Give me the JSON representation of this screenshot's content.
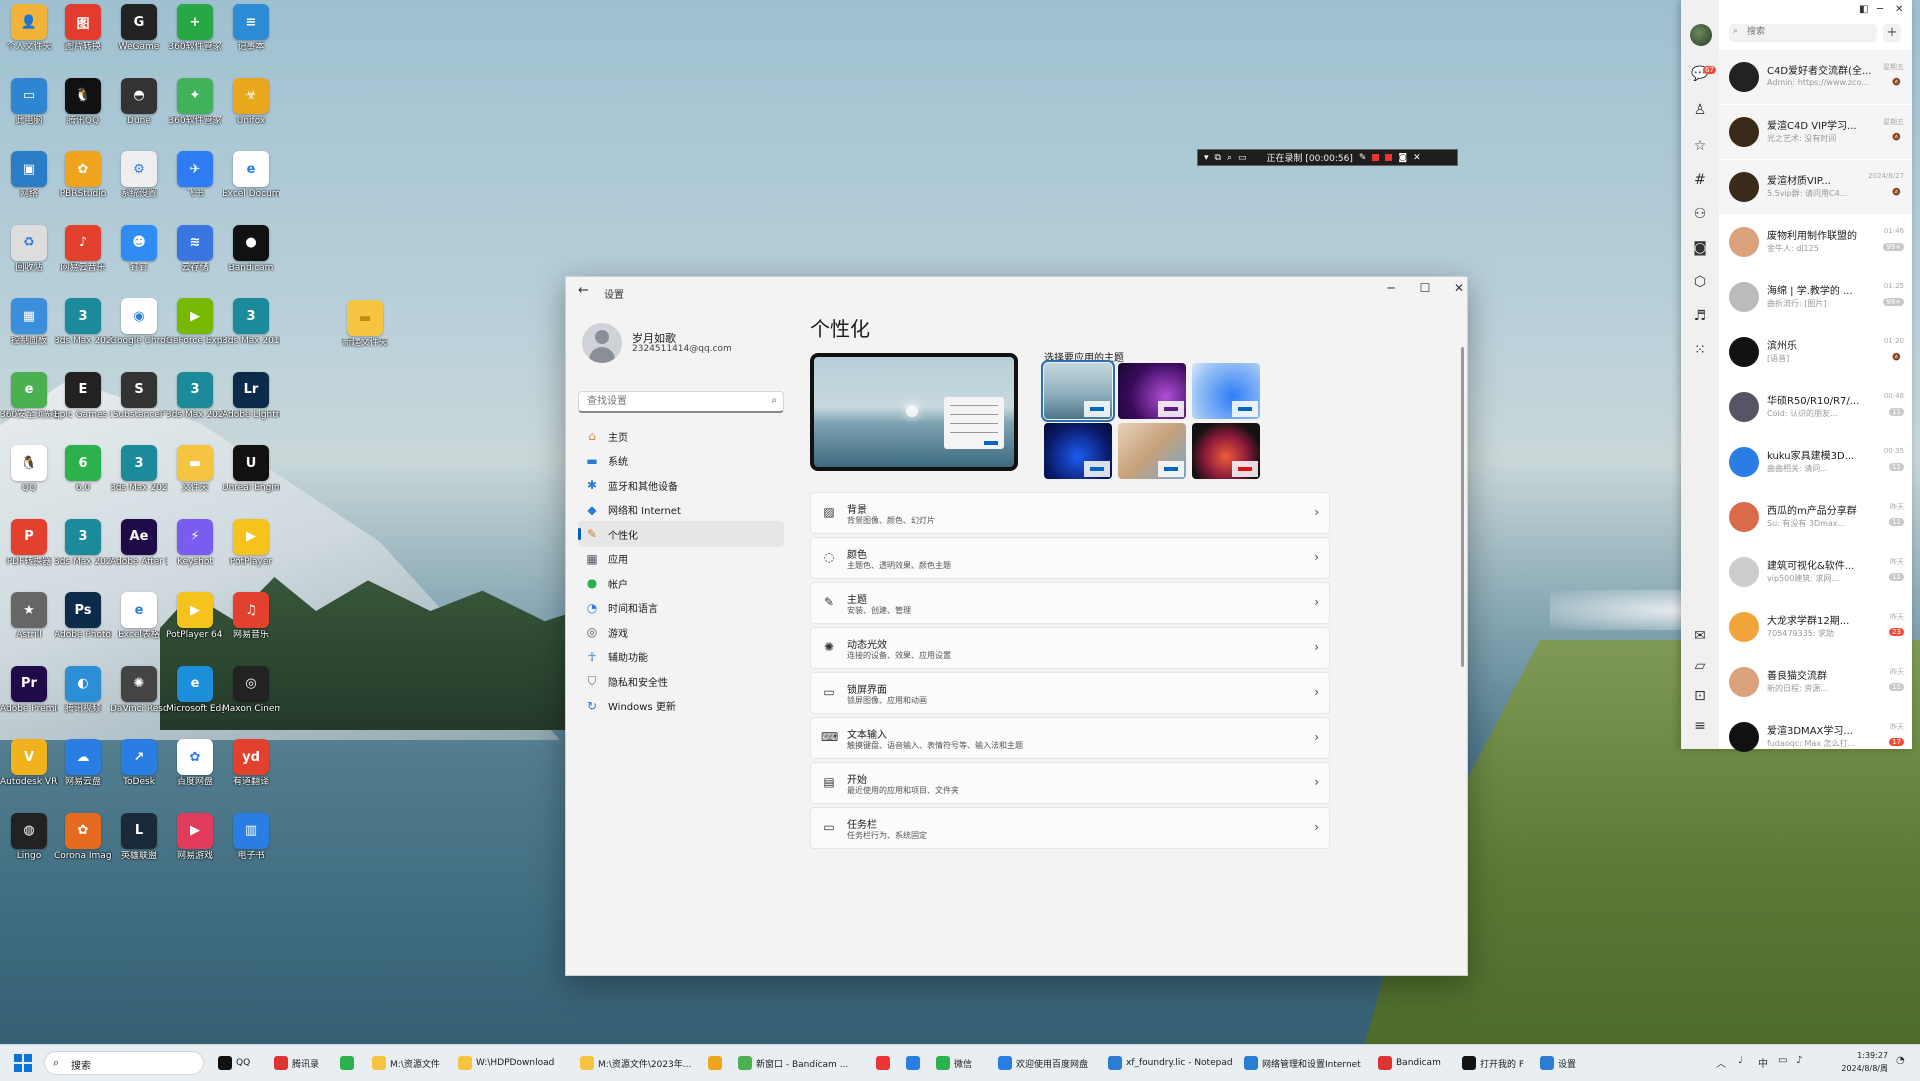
{
  "desktop": {
    "icons": [
      {
        "label": "个人文件夹",
        "color": "#f1b33a",
        "glyph": "👤"
      },
      {
        "label": "图片转换",
        "color": "#e33b2e",
        "glyph": "图"
      },
      {
        "label": "WeGame",
        "color": "#222",
        "glyph": "G"
      },
      {
        "label": "360软件管家",
        "color": "#27a844",
        "glyph": "+"
      },
      {
        "label": "记事本",
        "color": "#2d8bd6",
        "glyph": "≡"
      },
      {
        "label": "此电脑",
        "color": "#2e86d2",
        "glyph": "▭"
      },
      {
        "label": "腾讯QQ",
        "color": "#111",
        "glyph": "🐧"
      },
      {
        "label": "Dune",
        "color": "#333",
        "glyph": "◓"
      },
      {
        "label": "360软件管家",
        "color": "#3fb25b",
        "glyph": "✦"
      },
      {
        "label": "Unifox",
        "color": "#e9a71d",
        "glyph": "☣"
      },
      {
        "label": "网络",
        "color": "#2a7ec8",
        "glyph": "▣"
      },
      {
        "label": "PBRStudio",
        "color": "#f0a31d",
        "glyph": "✿"
      },
      {
        "label": "系统设置",
        "color": "#eee",
        "glyph": "⚙"
      },
      {
        "label": "飞书",
        "color": "#2e7cf6",
        "glyph": "✈"
      },
      {
        "label": "Excel Document",
        "color": "#fff",
        "glyph": "e"
      },
      {
        "label": "回收站",
        "color": "#ddd",
        "glyph": "♻"
      },
      {
        "label": "网易云音乐",
        "color": "#e3402e",
        "glyph": "♪"
      },
      {
        "label": "钉钉",
        "color": "#2f8cf2",
        "glyph": "☻"
      },
      {
        "label": "云存储",
        "color": "#3a76e0",
        "glyph": "≋"
      },
      {
        "label": "Bandicam",
        "color": "#111",
        "glyph": "●"
      },
      {
        "label": "控制面板",
        "color": "#3b8edb",
        "glyph": "▦"
      },
      {
        "label": "3ds Max 2020",
        "color": "#1b8a9a",
        "glyph": "3"
      },
      {
        "label": "Google Chrome",
        "color": "#fff",
        "glyph": "◉"
      },
      {
        "label": "GeForce Experience",
        "color": "#76b900",
        "glyph": "▶"
      },
      {
        "label": "3ds Max 2018",
        "color": "#1b8a9a",
        "glyph": "3"
      },
      {
        "label": "360安全浏览器",
        "color": "#4bb04f",
        "glyph": "e"
      },
      {
        "label": "Epic Games Launcher",
        "color": "#222",
        "glyph": "E"
      },
      {
        "label": "SubstanceP",
        "color": "#333",
        "glyph": "S"
      },
      {
        "label": "3ds Max 2020",
        "color": "#1b8a9a",
        "glyph": "3"
      },
      {
        "label": "Adobe Lightroom",
        "color": "#0c2a4a",
        "glyph": "Lr"
      },
      {
        "label": "QQ",
        "color": "#fff",
        "glyph": "🐧"
      },
      {
        "label": "6.0",
        "color": "#2bb24c",
        "glyph": "6"
      },
      {
        "label": "3ds Max 2021",
        "color": "#1b8a9a",
        "glyph": "3"
      },
      {
        "label": "文件夹",
        "color": "#f5c542",
        "glyph": "▬"
      },
      {
        "label": "Unreal Engine",
        "color": "#111",
        "glyph": "U"
      },
      {
        "label": "PDF转换器",
        "color": "#e3402e",
        "glyph": "P"
      },
      {
        "label": "3ds Max 2021",
        "color": "#1b8a9a",
        "glyph": "3"
      },
      {
        "label": "Adobe After Effects 2022",
        "color": "#1f0a4a",
        "glyph": "Ae"
      },
      {
        "label": "Keyshot",
        "color": "#7a5cf0",
        "glyph": "⚡"
      },
      {
        "label": "PotPlayer",
        "color": "#f6c21c",
        "glyph": "▶"
      },
      {
        "label": "Astrill",
        "color": "#666",
        "glyph": "★"
      },
      {
        "label": "Adobe Photoshop",
        "color": "#0c2a4a",
        "glyph": "Ps"
      },
      {
        "label": "Excel表格",
        "color": "#fff",
        "glyph": "e"
      },
      {
        "label": "PotPlayer 64 bit",
        "color": "#f6c21c",
        "glyph": "▶"
      },
      {
        "label": "网易音乐",
        "color": "#e3402e",
        "glyph": "♫"
      },
      {
        "label": "Adobe Premiere",
        "color": "#1f0a4a",
        "glyph": "Pr"
      },
      {
        "label": "腾讯视频",
        "color": "#2b8ed6",
        "glyph": "◐"
      },
      {
        "label": "DaVinci Resolve",
        "color": "#444",
        "glyph": "✺"
      },
      {
        "label": "Microsoft Edge",
        "color": "#1b8fd9",
        "glyph": "e"
      },
      {
        "label": "Maxon Cinema 4D",
        "color": "#222",
        "glyph": "◎"
      },
      {
        "label": "Autodesk VRED",
        "color": "#f0b21d",
        "glyph": "V"
      },
      {
        "label": "网易云盘",
        "color": "#2a7ee3",
        "glyph": "☁"
      },
      {
        "label": "ToDesk",
        "color": "#2a7ee3",
        "glyph": "↗"
      },
      {
        "label": "百度网盘",
        "color": "#fff",
        "glyph": "✿"
      },
      {
        "label": "有道翻译",
        "color": "#e3402e",
        "glyph": "yd"
      },
      {
        "label": "Lingo",
        "color": "#222",
        "glyph": "◍"
      },
      {
        "label": "Corona Image",
        "color": "#e66b1f",
        "glyph": "✿"
      },
      {
        "label": "英雄联盟",
        "color": "#1a2a3a",
        "glyph": "L"
      },
      {
        "label": "网易游戏",
        "color": "#e33b5b",
        "glyph": "▶"
      },
      {
        "label": "电子书",
        "color": "#2a7ee3",
        "glyph": "▥"
      }
    ],
    "folder_label": "新建文件夹"
  },
  "recorder": {
    "status": "正在录制 [00:00:56]"
  },
  "settings": {
    "title_bar": "设置",
    "user": {
      "name": "岁月如歌",
      "email": "2324511414@qq.com"
    },
    "search_placeholder": "查找设置",
    "nav": [
      {
        "label": "主页",
        "icon": "⌂",
        "color": "#e0893b"
      },
      {
        "label": "系统",
        "icon": "▬",
        "color": "#2b7cd3"
      },
      {
        "label": "蓝牙和其他设备",
        "icon": "✱",
        "color": "#2b7cd3"
      },
      {
        "label": "网络和 Internet",
        "icon": "◆",
        "color": "#2b7cd3"
      },
      {
        "label": "个性化",
        "icon": "✎",
        "color": "#d37a2b"
      },
      {
        "label": "应用",
        "icon": "▦",
        "color": "#556"
      },
      {
        "label": "帐户",
        "icon": "●",
        "color": "#2bb24c"
      },
      {
        "label": "时间和语言",
        "icon": "◔",
        "color": "#2b7cd3"
      },
      {
        "label": "游戏",
        "icon": "◎",
        "color": "#556"
      },
      {
        "label": "辅助功能",
        "icon": "☥",
        "color": "#2b7cd3"
      },
      {
        "label": "隐私和安全性",
        "icon": "⛉",
        "color": "#666"
      },
      {
        "label": "Windows 更新",
        "icon": "↻",
        "color": "#2b7cd3"
      }
    ],
    "page_title": "个性化",
    "themes_label": "选择要应用的主题",
    "themes": [
      {
        "name": "theme-1",
        "bg": "linear-gradient(180deg,#c4d7de,#8fb0bd 55%,#4b7688)",
        "accent": "#0067c0"
      },
      {
        "name": "theme-2",
        "bg": "radial-gradient(circle at 70% 60%,#b04fd8,#3a0b5c 60%,#1a0630)",
        "accent": "#5a1f7a"
      },
      {
        "name": "theme-3",
        "bg": "radial-gradient(circle at 60% 60%,#2e7cf6,#9bc3f5 70%,#dce9f8)",
        "accent": "#0067c0"
      },
      {
        "name": "theme-4",
        "bg": "radial-gradient(circle at 50% 60%,#1d5cf0,#0a1a6a 65%,#040a30)",
        "accent": "#0067c0"
      },
      {
        "name": "theme-5",
        "bg": "linear-gradient(135deg,#e9d2b8,#c5a17a 50%,#7aa7c7)",
        "accent": "#0067c0"
      },
      {
        "name": "theme-6",
        "bg": "radial-gradient(circle at 50% 60%,#f05a3a,#8a1a3a 45%,#111 75%)",
        "accent": "#d11"
      }
    ],
    "rows": [
      {
        "title": "背景",
        "sub": "背景图像、颜色、幻灯片",
        "icon": "▨"
      },
      {
        "title": "颜色",
        "sub": "主题色、透明效果、颜色主题",
        "icon": "◌"
      },
      {
        "title": "主题",
        "sub": "安装、创建、管理",
        "icon": "✎"
      },
      {
        "title": "动态光效",
        "sub": "连接的设备、效果、应用设置",
        "icon": "✺"
      },
      {
        "title": "锁屏界面",
        "sub": "锁屏图像、应用和动画",
        "icon": "▭"
      },
      {
        "title": "文本输入",
        "sub": "触摸键盘、语音输入、表情符号等、输入法和主题",
        "icon": "⌨"
      },
      {
        "title": "开始",
        "sub": "最近使用的应用和项目、文件夹",
        "icon": "▤"
      },
      {
        "title": "任务栏",
        "sub": "任务栏行为、系统固定",
        "icon": "▭"
      }
    ]
  },
  "qq": {
    "search_placeholder": "搜索",
    "badge": "67",
    "chats": [
      {
        "name": "C4D爱好者交流群(全...",
        "msg": "Admin: https://www.zco...",
        "time": "星期五",
        "color": "#222",
        "badge": "",
        "pin": true
      },
      {
        "name": "爱渲C4D VIP学习...",
        "msg": "光之艺术: 没有时间",
        "time": "星期五",
        "color": "#3a2a1a",
        "badge": "",
        "pin": true
      },
      {
        "name": "爱渲材质VIP...",
        "msg": "5.5vip群: 请问用C4...",
        "time": "2024/8/27",
        "color": "#3a2a1a",
        "badge": "",
        "pin": true
      },
      {
        "name": "废物利用制作联盟的",
        "msg": "金牛人: dl125",
        "time": "01:46",
        "color": "#d9a27a",
        "badge": "99+",
        "pin": false
      },
      {
        "name": "海绵 | 学.教学的 ...",
        "msg": "曲折流行: [图片]",
        "time": "01:25",
        "color": "#bbb",
        "badge": "99+",
        "pin": false
      },
      {
        "name": "滨州乐",
        "msg": "[语音]",
        "time": "01:20",
        "color": "#111",
        "badge": "",
        "pin": false
      },
      {
        "name": "华硕R50/R10/R7/...",
        "msg": "Cold: 认识的朋友...",
        "time": "00:48",
        "color": "#556",
        "badge": "11",
        "pin": false
      },
      {
        "name": "kuku家具建模3D...",
        "msg": "曲曲相关: 请问...",
        "time": "00:35",
        "color": "#2a7ee3",
        "badge": "11",
        "pin": false
      },
      {
        "name": "西瓜的m产品分享群",
        "msg": "Su: 有没有 3Dmax...",
        "time": "昨天",
        "color": "#d96a4a",
        "badge": "11",
        "pin": false
      },
      {
        "name": "建筑可视化&软件...",
        "msg": "vip500建筑: 求网...",
        "time": "昨天",
        "color": "#ccc",
        "badge": "11",
        "pin": false
      },
      {
        "name": "大龙求学群12期...",
        "msg": "705479335: 求助",
        "time": "昨天",
        "color": "#f0a43a",
        "badge": "23",
        "pin": false
      },
      {
        "name": "善良猫交流群",
        "msg": "新的日程: 资源...",
        "time": "昨天",
        "color": "#d9a27a",
        "badge": "11",
        "pin": false
      },
      {
        "name": "爱渲3DMAX学习...",
        "msg": "fudaoqc: Max 怎么打...",
        "time": "昨天",
        "color": "#111",
        "badge": "17",
        "pin": false
      }
    ]
  },
  "taskbar": {
    "search": "搜索",
    "items": [
      {
        "label": "QQ",
        "color": "#111"
      },
      {
        "label": "腾讯录",
        "color": "#d33"
      },
      {
        "label": "",
        "color": "#2bb24c"
      },
      {
        "label": "M:\\资源文件",
        "color": "#f5c542"
      },
      {
        "label": "W:\\HDPDownload",
        "color": "#f5c542"
      },
      {
        "label": "M:\\资源文件\\2023年...",
        "color": "#f5c542"
      },
      {
        "label": "",
        "color": "#f0a31d"
      },
      {
        "label": "新窗口 - Bandicam ...",
        "color": "#4bb04f"
      },
      {
        "label": "",
        "color": "#e33"
      },
      {
        "label": "",
        "color": "#2a7ee3"
      },
      {
        "label": "微信",
        "color": "#2bb24c"
      },
      {
        "label": "欢迎使用百度网盘",
        "color": "#2a7ee3"
      },
      {
        "label": "xf_foundry.lic - Notepad",
        "color": "#2b7cd3"
      },
      {
        "label": "网络管理和设置Internet",
        "color": "#2b7cd3"
      },
      {
        "label": "Bandicam",
        "color": "#d33"
      },
      {
        "label": "打开我的 F",
        "color": "#111"
      },
      {
        "label": "设置",
        "color": "#2b7cd3"
      }
    ],
    "time": "1:39:27",
    "date": "2024/8/8/周"
  }
}
